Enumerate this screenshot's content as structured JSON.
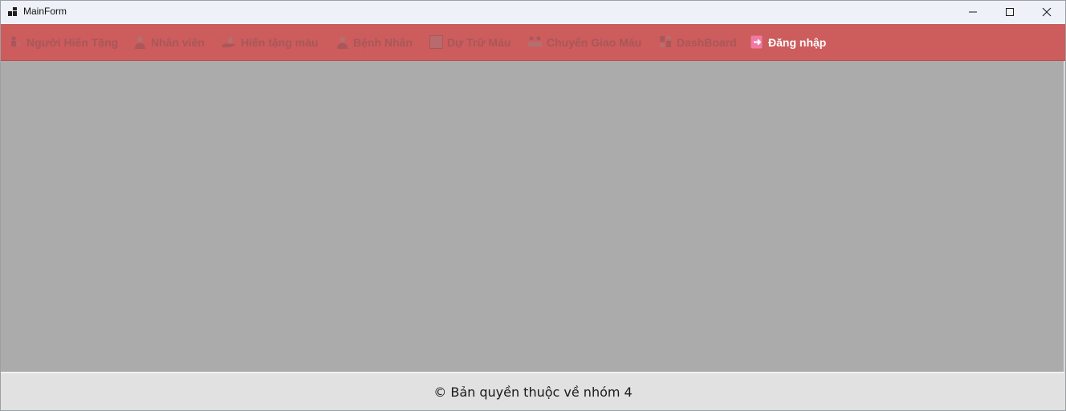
{
  "window": {
    "title": "MainForm"
  },
  "menu": {
    "items": [
      {
        "label": "Người Hiến Tặng",
        "icon": "donor-icon"
      },
      {
        "label": "Nhân viên",
        "icon": "staff-icon"
      },
      {
        "label": "Hiến tặng máu",
        "icon": "blood-donation-icon"
      },
      {
        "label": "Bệnh Nhân",
        "icon": "patient-icon"
      },
      {
        "label": "Dự Trữ Máu",
        "icon": "blood-storage-icon"
      },
      {
        "label": "Chuyển Giao Máu",
        "icon": "blood-transfer-icon"
      },
      {
        "label": "DashBoard",
        "icon": "dashboard-icon"
      },
      {
        "label": "Đăng nhập",
        "icon": "login-icon"
      }
    ]
  },
  "footer": {
    "copyright": "© Bản quyền thuộc về nhóm 4"
  },
  "colors": {
    "menubar": "#cd5c5c",
    "menu_text_disabled": "#a8575a",
    "menu_text_active": "#ffffff",
    "content_bg": "#ababab",
    "footer_bg": "#e1e1e1"
  }
}
